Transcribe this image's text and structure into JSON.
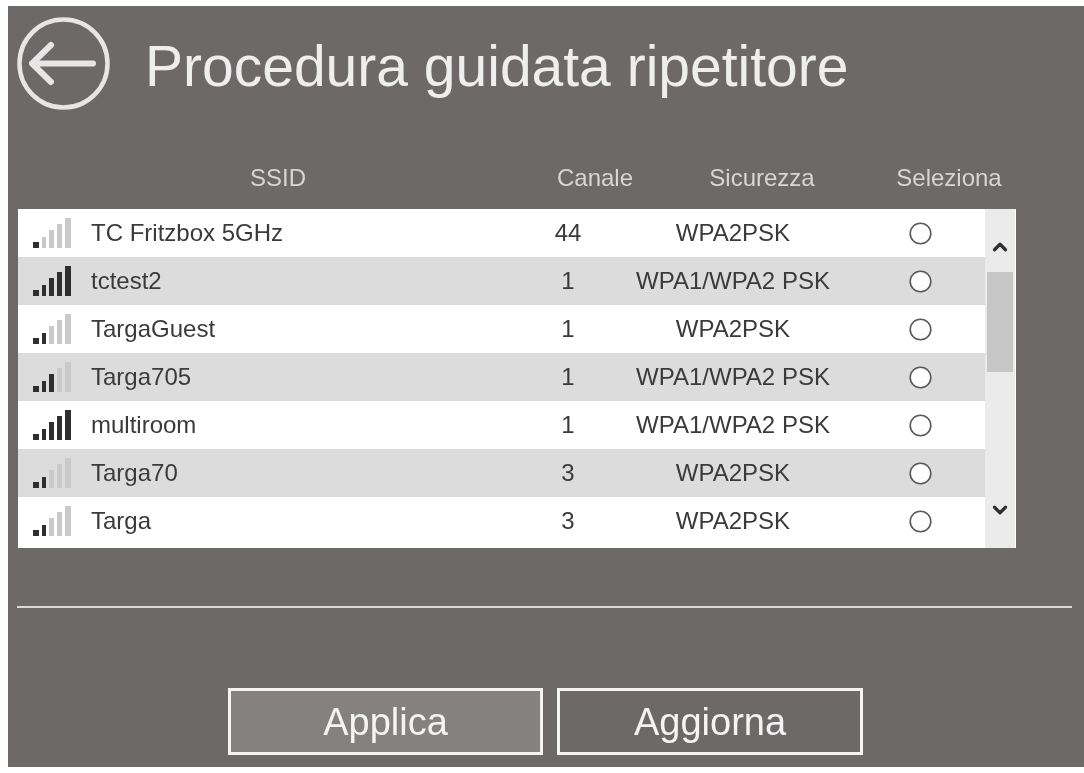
{
  "header": {
    "title": "Procedura guidata ripetitore"
  },
  "table": {
    "columns": [
      "SSID",
      "Canale",
      "Sicurezza",
      "Seleziona"
    ],
    "rows": [
      {
        "kind": "weak",
        "ssid": "TC Fritzbox 5GHz",
        "channel": "44",
        "security": "WPA2PSK",
        "selected": false
      },
      {
        "kind": "excellent",
        "ssid": "tctest2",
        "channel": "1",
        "security": "WPA1/WPA2 PSK",
        "selected": false
      },
      {
        "kind": "fair",
        "ssid": "TargaGuest",
        "channel": "1",
        "security": "WPA2PSK",
        "selected": false
      },
      {
        "kind": "good",
        "ssid": "Targa705",
        "channel": "1",
        "security": "WPA1/WPA2 PSK",
        "selected": false
      },
      {
        "kind": "excellent",
        "ssid": "multiroom",
        "channel": "1",
        "security": "WPA1/WPA2 PSK",
        "selected": false
      },
      {
        "kind": "fair",
        "ssid": "Targa70",
        "channel": "3",
        "security": "WPA2PSK",
        "selected": false
      },
      {
        "kind": "fair",
        "ssid": "Targa",
        "channel": "3",
        "security": "WPA2PSK",
        "selected": false
      }
    ]
  },
  "buttons": [
    {
      "label": "Applica",
      "highlighted": true
    },
    {
      "label": "Aggiorna",
      "highlighted": false
    }
  ]
}
